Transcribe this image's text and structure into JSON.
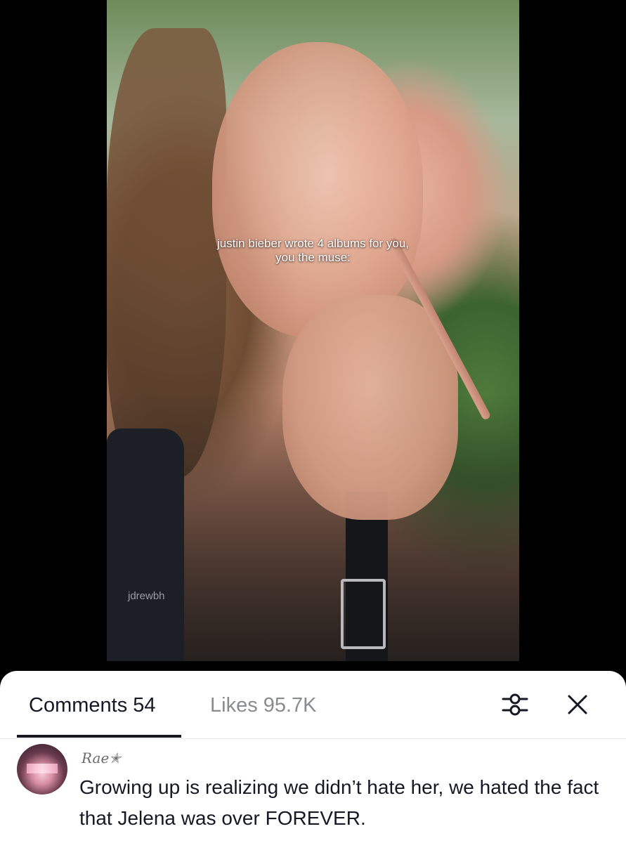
{
  "video": {
    "caption_line1": "justin bieber wrote 4 albums for you,",
    "caption_line2": "you the muse:",
    "watermark": "jdrewbh"
  },
  "comments_panel": {
    "tabs": [
      {
        "label": "Comments",
        "count": "54"
      },
      {
        "label": "Likes",
        "count": "95.7K"
      }
    ],
    "active_tab": "Comments",
    "icons": {
      "filter": "sliders-icon",
      "close": "close-icon"
    },
    "colors": {
      "active_text": "#161823",
      "inactive_text": "#8a8b91",
      "sheet_background": "#ffffff"
    }
  },
  "comments": [
    {
      "username": "Rae✭",
      "text": "Growing up is realizing we didn’t hate her, we hated the fact that Jelena was over FOREVER."
    }
  ]
}
